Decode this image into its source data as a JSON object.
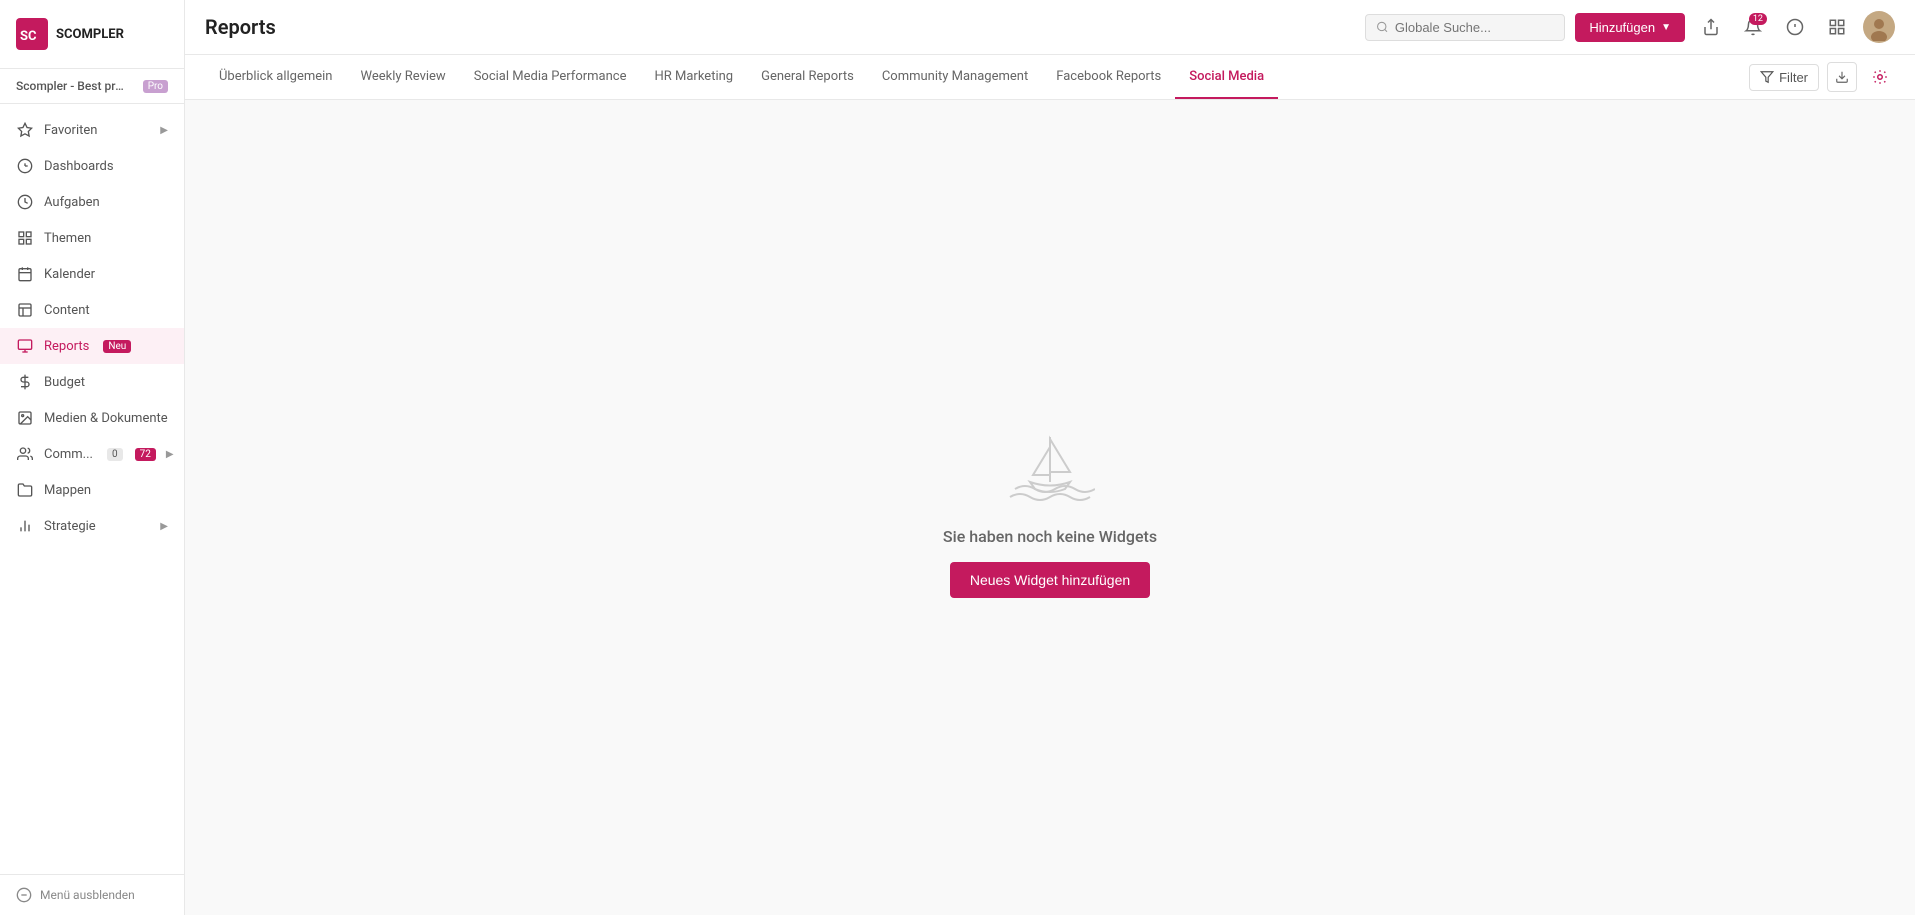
{
  "app": {
    "logo_text": "SCOMPLER"
  },
  "workspace": {
    "name": "Scompler - Best practi...",
    "badge": "Pro"
  },
  "sidebar": {
    "items": [
      {
        "id": "favoriten",
        "label": "Favoriten",
        "icon": "star",
        "has_arrow": true
      },
      {
        "id": "dashboards",
        "label": "Dashboards",
        "icon": "dashboard"
      },
      {
        "id": "aufgaben",
        "label": "Aufgaben",
        "icon": "tasks"
      },
      {
        "id": "themen",
        "label": "Themen",
        "icon": "themes"
      },
      {
        "id": "kalender",
        "label": "Kalender",
        "icon": "calendar"
      },
      {
        "id": "content",
        "label": "Content",
        "icon": "content"
      },
      {
        "id": "reports",
        "label": "Reports",
        "icon": "reports",
        "badge_new": "Neu",
        "active": true
      },
      {
        "id": "budget",
        "label": "Budget",
        "icon": "budget"
      },
      {
        "id": "medien",
        "label": "Medien & Dokumente",
        "icon": "media"
      },
      {
        "id": "community",
        "label": "Comm...",
        "icon": "community",
        "badge_count": "0",
        "badge_count2": "72",
        "has_arrow": true
      },
      {
        "id": "mappen",
        "label": "Mappen",
        "icon": "folder"
      },
      {
        "id": "strategie",
        "label": "Strategie",
        "icon": "strategy",
        "has_arrow": true
      }
    ],
    "footer": {
      "hide_label": "Menü ausblenden"
    }
  },
  "header": {
    "title": "Reports",
    "search_placeholder": "Globale Suche...",
    "add_button_label": "Hinzufügen",
    "notification_count": "12"
  },
  "tabs": {
    "items": [
      {
        "id": "ueberblick",
        "label": "Überblick allgemein"
      },
      {
        "id": "weekly",
        "label": "Weekly Review"
      },
      {
        "id": "social-performance",
        "label": "Social Media Performance"
      },
      {
        "id": "hr-marketing",
        "label": "HR Marketing"
      },
      {
        "id": "general",
        "label": "General Reports"
      },
      {
        "id": "community",
        "label": "Community Management"
      },
      {
        "id": "facebook",
        "label": "Facebook Reports"
      },
      {
        "id": "social-media",
        "label": "Social Media",
        "active": true
      }
    ],
    "filter_label": "Filter"
  },
  "empty_state": {
    "message": "Sie haben noch keine Widgets",
    "button_label": "Neues Widget hinzufügen"
  }
}
